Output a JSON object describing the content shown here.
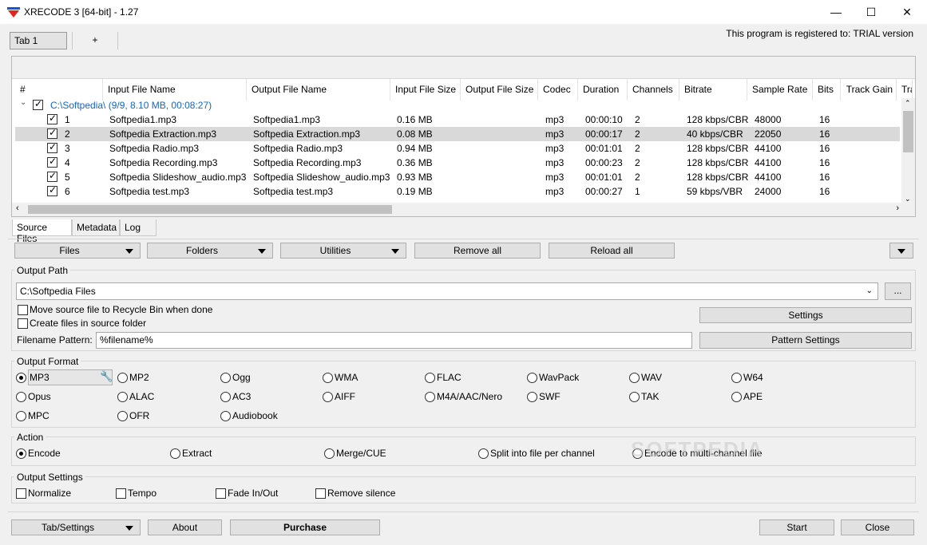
{
  "window": {
    "title": "XRECODE 3 [64-bit] - 1.27",
    "minimize": "—",
    "maximize": "☐",
    "close": "✕"
  },
  "tabs": {
    "tab1": "Tab 1",
    "add": "+"
  },
  "registered": "This program is registered to: TRIAL version",
  "list": {
    "columns": [
      "#",
      "Input File Name",
      "Output File Name",
      "Input File Size",
      "Output File Size",
      "Codec",
      "Duration",
      "Channels",
      "Bitrate",
      "Sample Rate",
      "Bits",
      "Track Gain",
      "Tra"
    ],
    "group": "C:\\Softpedia\\ (9/9, 8.10 MB, 00:08:27)",
    "rows": [
      {
        "n": "1",
        "in": "Softpedia1.mp3",
        "out": "Softpedia1.mp3",
        "isize": "0.16 MB",
        "codec": "mp3",
        "dur": "00:00:10",
        "ch": "2",
        "br": "128 kbps/CBR",
        "sr": "48000",
        "bits": "16"
      },
      {
        "n": "2",
        "in": "Softpedia Extraction.mp3",
        "out": "Softpedia Extraction.mp3",
        "isize": "0.08 MB",
        "codec": "mp3",
        "dur": "00:00:17",
        "ch": "2",
        "br": "40 kbps/CBR",
        "sr": "22050",
        "bits": "16"
      },
      {
        "n": "3",
        "in": "Softpedia Radio.mp3",
        "out": "Softpedia Radio.mp3",
        "isize": "0.94 MB",
        "codec": "mp3",
        "dur": "00:01:01",
        "ch": "2",
        "br": "128 kbps/CBR",
        "sr": "44100",
        "bits": "16"
      },
      {
        "n": "4",
        "in": "Softpedia Recording.mp3",
        "out": "Softpedia Recording.mp3",
        "isize": "0.36 MB",
        "codec": "mp3",
        "dur": "00:00:23",
        "ch": "2",
        "br": "128 kbps/CBR",
        "sr": "44100",
        "bits": "16"
      },
      {
        "n": "5",
        "in": "Softpedia Slideshow_audio.mp3",
        "out": "Softpedia Slideshow_audio.mp3",
        "isize": "0.93 MB",
        "codec": "mp3",
        "dur": "00:01:01",
        "ch": "2",
        "br": "128 kbps/CBR",
        "sr": "44100",
        "bits": "16"
      },
      {
        "n": "6",
        "in": "Softpedia test.mp3",
        "out": "Softpedia test.mp3",
        "isize": "0.19 MB",
        "codec": "mp3",
        "dur": "00:00:27",
        "ch": "1",
        "br": "59 kbps/VBR",
        "sr": "24000",
        "bits": "16"
      }
    ]
  },
  "listTabs": [
    "Source Files",
    "Metadata",
    "Log"
  ],
  "toolbar": {
    "files": "Files",
    "folders": "Folders",
    "utilities": "Utilities",
    "remove_all": "Remove all",
    "reload_all": "Reload all"
  },
  "output_path": {
    "title": "Output Path",
    "value": "C:\\Softpedia Files",
    "browse": "...",
    "move_recycle": "Move source file to Recycle Bin when done",
    "create_in_source": "Create files in source folder",
    "settings": "Settings",
    "pattern_label": "Filename Pattern:",
    "pattern_value": "%filename%",
    "pattern_settings": "Pattern Settings"
  },
  "output_format": {
    "title": "Output Format",
    "selected": "MP3",
    "formats": [
      "MP3",
      "MP2",
      "Ogg",
      "WMA",
      "FLAC",
      "WavPack",
      "WAV",
      "W64",
      "Opus",
      "ALAC",
      "AC3",
      "AIFF",
      "M4A/AAC/Nero",
      "SWF",
      "TAK",
      "APE",
      "MPC",
      "OFR",
      "Audiobook"
    ]
  },
  "action": {
    "title": "Action",
    "options": [
      "Encode",
      "Extract",
      "Merge/CUE",
      "Split into file per channel",
      "Encode to multi-channel file"
    ],
    "selected": "Encode"
  },
  "output_settings": {
    "title": "Output Settings",
    "options": [
      "Normalize",
      "Tempo",
      "Fade In/Out",
      "Remove silence"
    ]
  },
  "footer": {
    "tab_settings": "Tab/Settings",
    "about": "About",
    "purchase": "Purchase",
    "start": "Start",
    "close": "Close"
  },
  "watermark": "SOFTPEDIA"
}
